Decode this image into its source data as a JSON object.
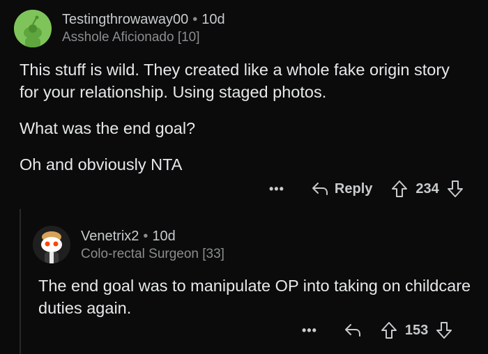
{
  "comment1": {
    "username": "Testingthrowaway00",
    "separator": "•",
    "age": "10d",
    "flair": "Asshole Aficionado [10]",
    "paragraphs": [
      "This stuff is wild. They created like a whole fake origin story for your relationship. Using staged photos.",
      "What was the end goal?",
      "Oh and obviously NTA"
    ],
    "more_label": "•••",
    "reply_label": "Reply",
    "score": "234"
  },
  "comment2": {
    "username": "Venetrix2",
    "separator": "•",
    "age": "10d",
    "flair": "Colo-rectal Surgeon [33]",
    "text": "The end goal was to manipulate OP into taking on childcare duties again.",
    "more_label": "•••",
    "score": "153"
  },
  "colors": {
    "background": "#0b0b0b",
    "avatar1": "#7fc45a",
    "text": "#e6e8ea",
    "muted": "#8a8d8f"
  },
  "icons": [
    "more-icon",
    "reply-icon",
    "upvote-icon",
    "downvote-icon"
  ]
}
